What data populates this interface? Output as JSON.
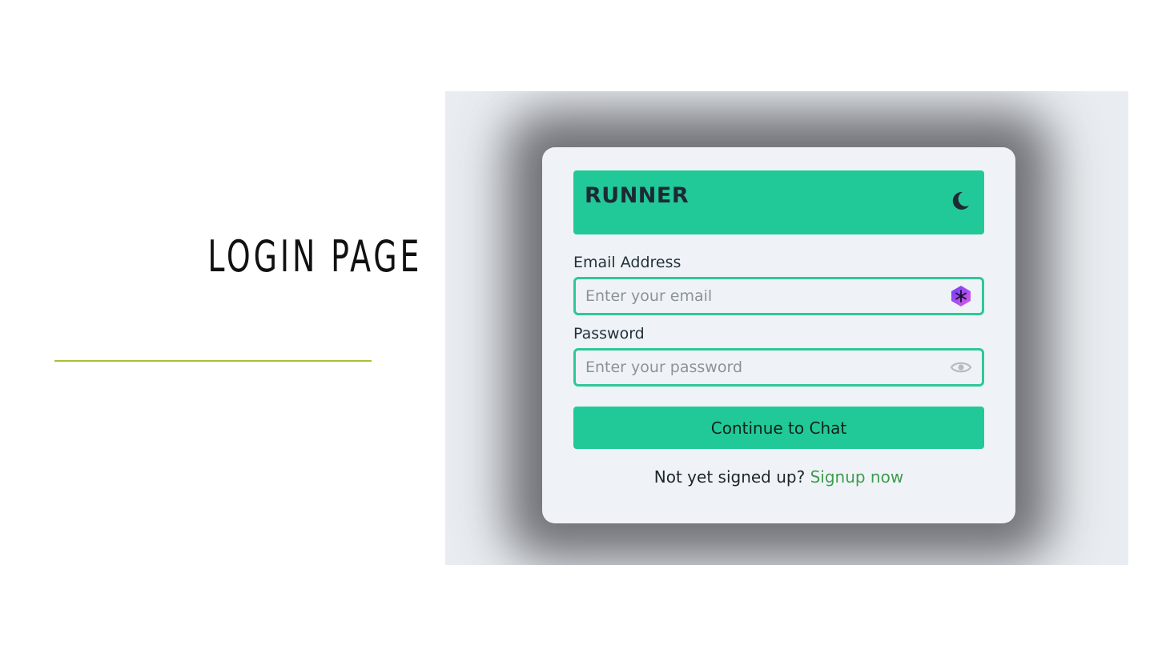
{
  "slide": {
    "title": "LOGIN PAGE"
  },
  "login": {
    "brand": "RUNNER",
    "theme_toggle_icon": "moon-icon",
    "email": {
      "label": "Email Address",
      "placeholder": "Enter your email",
      "value": "",
      "icon": "password-manager-icon"
    },
    "password": {
      "label": "Password",
      "placeholder": "Enter your password",
      "value": "",
      "icon": "eye-icon"
    },
    "submit_label": "Continue to Chat",
    "signup_prompt": "Not yet signed up?",
    "signup_link": "Signup now"
  },
  "colors": {
    "accent": "#22c998",
    "input_border": "#2fc897",
    "link": "#3f9b4c",
    "title_rule": "#a7c13a",
    "card_background": "#eff3f7"
  }
}
